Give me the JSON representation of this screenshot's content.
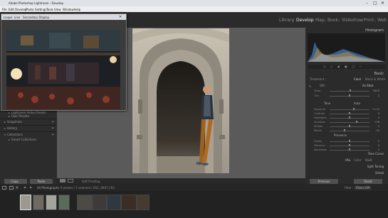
{
  "window": {
    "title": "Adobe Photoshop Lightroom - Develop"
  },
  "menu": [
    "File",
    "Edit",
    "Develop",
    "Photo",
    "Settings",
    "Tools",
    "View",
    "Window",
    "Help"
  ],
  "modules": [
    "Library",
    "Develop",
    "Map",
    "Book",
    "Slideshow",
    "Print",
    "Web"
  ],
  "active_module": "Develop",
  "secondary_window": {
    "tabs": [
      "Loupe",
      "Live",
      "Secondary Display"
    ]
  },
  "left_panel": {
    "items": [
      {
        "label": "Lightroom Video Presets",
        "type": "preset-item"
      },
      {
        "label": "User Presets",
        "type": "preset-item"
      },
      {
        "label": "Snapshots",
        "type": "section"
      },
      {
        "label": "History",
        "type": "section"
      },
      {
        "label": "Collections",
        "type": "section"
      },
      {
        "label": "Smart Collections",
        "type": "preset-item"
      }
    ],
    "copy_button": "Copy...",
    "paste_button": "Paste"
  },
  "toolbar": {
    "label": "Soft Proofing"
  },
  "right_panel": {
    "histogram_label": "Histogram",
    "basic_label": "Basic",
    "treatment_label": "Treatment :",
    "treatment_options": [
      "Color",
      "Black & White"
    ],
    "wb_label": "WB :",
    "wb_value": "As Shot",
    "tone_label": "Tone",
    "tone_auto": "Auto",
    "presence_label": "Presence",
    "sliders": [
      {
        "label": "Temp",
        "value": "5800",
        "level": 0.52
      },
      {
        "label": "Tint",
        "value": "0",
        "level": 0.5
      },
      {
        "label": "Exposure",
        "value": "+1.15",
        "level": 0.62
      },
      {
        "label": "Contrast",
        "value": "0",
        "level": 0.5
      },
      {
        "label": "Highlights",
        "value": "0",
        "level": 0.5
      },
      {
        "label": "Shadows",
        "value": "+36",
        "level": 0.68
      },
      {
        "label": "Whites",
        "value": "0",
        "level": 0.5
      },
      {
        "label": "Blacks",
        "value": "-29",
        "level": 0.38
      },
      {
        "label": "Clarity",
        "value": "0",
        "level": 0.5
      },
      {
        "label": "Vibrance",
        "value": "0",
        "level": 0.5
      },
      {
        "label": "Saturation",
        "value": "0",
        "level": 0.5
      }
    ],
    "sections": [
      "Tone Curve",
      "HSL / Color / B&W",
      "Split Toning",
      "Detail"
    ],
    "hsl_tabs": [
      "HSL",
      "Color",
      "B&W"
    ],
    "previous_button": "Previous",
    "reset_button": "Reset"
  },
  "filmstrip": {
    "source": "All Photographs",
    "info": "9 photos / 1 selected / DSC_0897.CR2",
    "filter_label": "Filter :",
    "filter_value": "Filters Off"
  }
}
